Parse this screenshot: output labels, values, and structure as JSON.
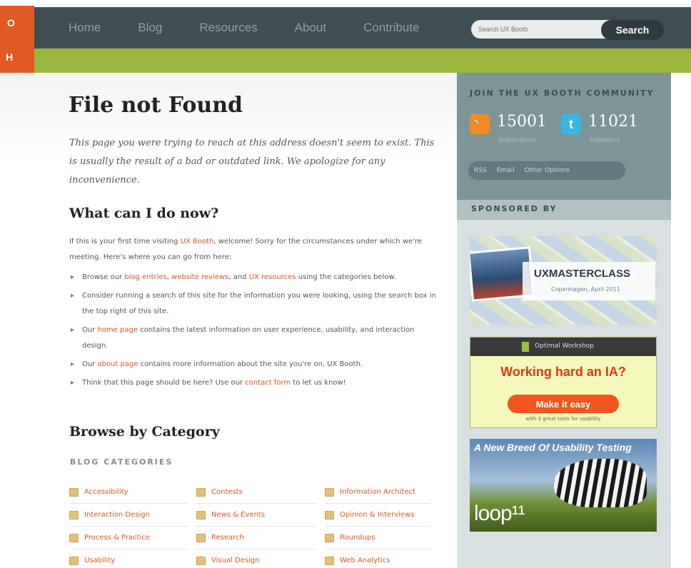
{
  "brand": {
    "tab_text_top": "O",
    "tab_text_bottom": "H"
  },
  "nav": {
    "items": [
      "Home",
      "Blog",
      "Resources",
      "About",
      "Contribute"
    ],
    "search_placeholder": "Search UX Booth",
    "search_button": "Search"
  },
  "main": {
    "title": "File not Found",
    "intro": "This page you were trying to reach at this address doesn't seem to exist. This is usually the result of a bad or outdated link. We apologize for any inconvenience.",
    "what_heading": "What can I do now?",
    "welcome": {
      "pre": "If this is your first time visiting ",
      "link": "UX Booth",
      "post": ", welcome! Sorry for the circumstances under which we're meeting. Here's where you can go from here:"
    },
    "bullets": [
      {
        "pre": "Browse our ",
        "links": [
          "blog entries",
          "website reviews"
        ],
        "mid": ", and ",
        "link3": "UX resources",
        "post": " using the categories below."
      },
      {
        "text": "Consider running a search of this site for the information you were looking, using the search box in the top right of this site."
      },
      {
        "pre": "Our ",
        "link": "home page",
        "post": " contains the latest information on user experience, usability, and interaction design."
      },
      {
        "pre": "Our ",
        "link": "about page",
        "post": " contains more information about the site you're on, UX Booth."
      },
      {
        "pre": "Think that this page should be here? Use our ",
        "link": "contact form",
        "post": " to let us know!"
      }
    ],
    "browse_heading": "Browse by Category",
    "categories_label": "BLOG CATEGORIES",
    "categories": [
      "Accessibility",
      "Contests",
      "Information Architect",
      "Interaction Design",
      "News & Events",
      "Opinion & Interviews",
      "Process & Practice",
      "Research",
      "Roundups",
      "Usability",
      "Visual Design",
      "Web Analytics"
    ]
  },
  "sidebar": {
    "community_title": "JOIN THE UX BOOTH COMMUNITY",
    "subscribers_count": "15001",
    "subscribers_label": "Subscribers",
    "followers_count": "11021",
    "followers_label": "Followers",
    "twitter_glyph": "t",
    "options": [
      "RSS",
      "Email",
      "Other Options"
    ],
    "sponsored_title": "SPONSORED BY",
    "ad1": {
      "title": "UXMASTERCLASS",
      "subtitle": "Copenhagen, April 2011"
    },
    "ad2": {
      "top": "Optimal Workshop",
      "headline": "Working hard an IA?",
      "button": "Make it easy",
      "sub": "with 3 great tools for usability"
    },
    "ad3": {
      "headline": "A New Breed Of Usability Testing",
      "logo": "loop¹¹"
    }
  },
  "colors": {
    "nav_bg": "#3f4e52",
    "accent_green": "#9db63f",
    "link": "#d4582a",
    "sidebar": "#7e9598"
  }
}
